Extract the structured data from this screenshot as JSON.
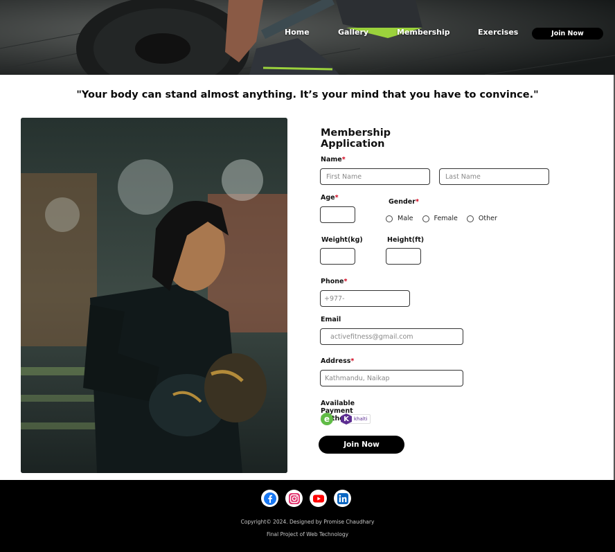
{
  "nav": {
    "items": [
      "Home",
      "Gallery",
      "Membership",
      "Exercises"
    ],
    "join_label": "Join Now"
  },
  "quote": "\"Your body can stand almost anything. It’s your mind that you have to convince.\"",
  "form": {
    "title": "Membership Application",
    "name_label": "Name",
    "first_name_placeholder": "First Name",
    "last_name_placeholder": "Last Name",
    "age_label": "Age",
    "gender_label": "Gender",
    "gender_options": [
      "Male",
      "Female",
      "Other"
    ],
    "weight_label": "Weight(kg)",
    "height_label": "Height(ft)",
    "phone_label": "Phone",
    "phone_placeholder": "+977-",
    "email_label": "Email",
    "email_placeholder": "activefitness@gmail.com",
    "address_label": "Address",
    "address_placeholder": "Kathmandu, Naikap",
    "payment_label": "Available Payment Methods",
    "payment_methods": [
      "esewa",
      "khalti"
    ],
    "khalti_text": "khalti",
    "submit_label": "Join Now",
    "required_mark": "*"
  },
  "footer": {
    "socials": [
      "facebook-icon",
      "instagram-icon",
      "youtube-icon",
      "linkedin-icon"
    ],
    "copyright": "Copyright© 2024. Designed by Promise Chaudhary",
    "subtitle": "Final Project of Web Technology"
  },
  "colors": {
    "accent": "#000000",
    "required": "#d0021b",
    "esewa": "#60bb46",
    "khalti": "#5c2d91"
  }
}
